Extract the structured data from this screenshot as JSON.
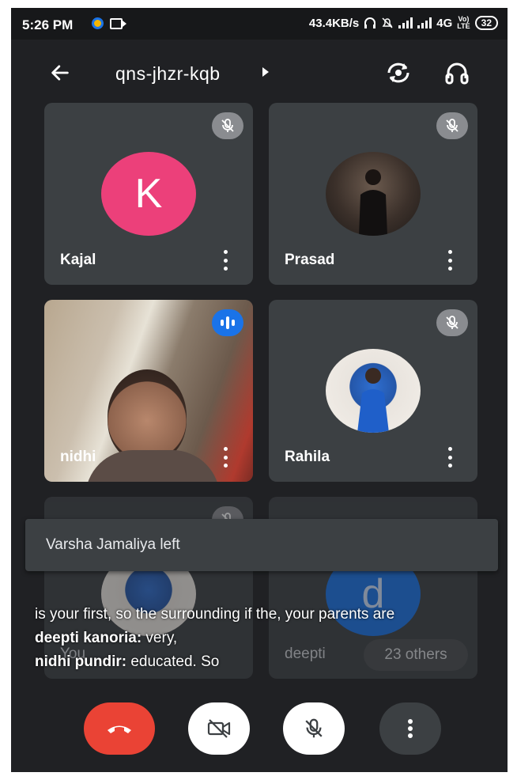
{
  "status_bar": {
    "time": "5:26 PM",
    "speed": "43.4KB/s",
    "network_top": "Vo)",
    "network_bottom": "LTE",
    "network": "4G",
    "battery": "32",
    "icons": [
      "meet-app-icon",
      "video-camera-icon",
      "headset-icon",
      "alarm-off-icon",
      "signal-icon",
      "signal-icon"
    ]
  },
  "topbar": {
    "title": "qns-jhzr-kqb",
    "back_icon": "arrow-left-icon",
    "flip_icon": "camera-flip-icon",
    "audio_icon": "headphones-icon"
  },
  "tiles": [
    {
      "name": "Kajal",
      "initial": "K",
      "avatar_color": "#ec407a",
      "muted": true
    },
    {
      "name": "Prasad",
      "muted": true
    },
    {
      "name": "nidhi",
      "speaking": true
    },
    {
      "name": "Rahila",
      "muted": true
    },
    {
      "name": "You",
      "muted": true
    },
    {
      "name": "deepti",
      "initial": "d",
      "avatar_color": "#1a73e8"
    }
  ],
  "others_label": "23 others",
  "toast": {
    "message": "Varsha Jamaliya left"
  },
  "captions": {
    "line1": "is your first, so the surrounding if the, your parents are",
    "lines": [
      {
        "speaker": "deepti kanoria:",
        "text": " very,"
      },
      {
        "speaker": "nidhi pundir:",
        "text": " educated. So"
      }
    ]
  },
  "controls": {
    "end_icon": "call-end-icon",
    "video_icon": "video-off-icon",
    "mic_icon": "mic-off-icon",
    "more_icon": "more-vertical-icon"
  },
  "colors": {
    "background": "#202124",
    "tile": "#3c4043",
    "end_call": "#ea4335",
    "speaking": "#1a73e8"
  }
}
